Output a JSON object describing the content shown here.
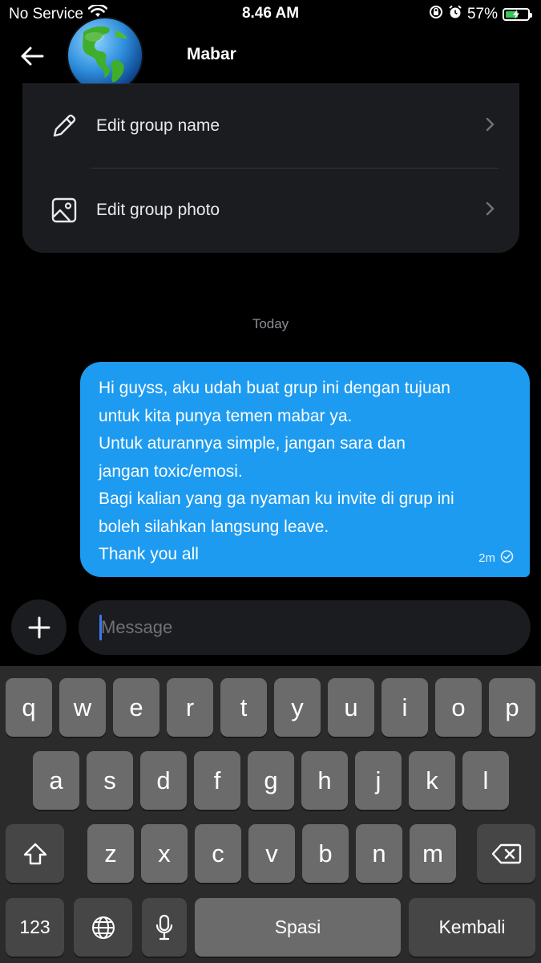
{
  "status_bar": {
    "carrier": "No Service",
    "time": "8.46 AM",
    "battery_percent": "57%",
    "battery_level": 0.57
  },
  "header": {
    "title": "Mabar",
    "back_icon": "arrow-left-icon",
    "avatar_icon": "globe-americas-icon"
  },
  "settings": {
    "items": [
      {
        "label": "Edit group name",
        "icon": "pencil-icon"
      },
      {
        "label": "Edit group photo",
        "icon": "image-icon"
      }
    ]
  },
  "chat": {
    "date_separator": "Today",
    "messages": [
      {
        "text": "Hi guyss, aku udah buat grup ini dengan tujuan\nuntuk kita punya temen mabar ya.\nUntuk aturannya simple, jangan sara dan\njangan toxic/emosi.\nBagi kalian yang ga nyaman ku invite di grup ini\nboleh silahkan langsung leave.\nThank you all",
        "time": "2m",
        "status_icon": "check-circle-icon"
      }
    ]
  },
  "composer": {
    "placeholder": "Message",
    "add_icon": "plus-icon"
  },
  "keyboard": {
    "row1": [
      "q",
      "w",
      "e",
      "r",
      "t",
      "y",
      "u",
      "i",
      "o",
      "p"
    ],
    "row2": [
      "a",
      "s",
      "d",
      "f",
      "g",
      "h",
      "j",
      "k",
      "l"
    ],
    "row3": [
      "z",
      "x",
      "c",
      "v",
      "b",
      "n",
      "m"
    ],
    "numbers_label": "123",
    "space_label": "Spasi",
    "return_label": "Kembali"
  },
  "colors": {
    "bubble": "#1d9bf0",
    "background": "#000000",
    "card": "#1b1c1f",
    "key": "#6b6b6b",
    "key_dark": "#464646"
  }
}
